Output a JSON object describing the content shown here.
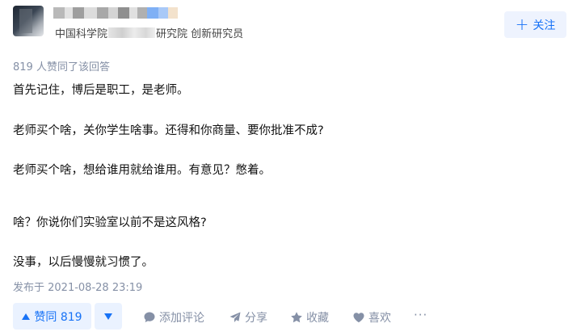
{
  "author": {
    "organization_prefix": "中国科学院",
    "organization_suffix": "研究院 创新研究员",
    "follow_label": "关注"
  },
  "answer": {
    "vote_summary": "819 人赞同了该回答",
    "paragraphs": [
      "首先记住，博后是职工，是老师。",
      "老师买个啥，关你学生啥事。还得和你商量、要你批准不成?",
      "老师买个啥，想给谁用就给谁用。有意见？憋着。",
      "啥？你说你们实验室以前不是这风格?",
      "没事，以后慢慢就习惯了。"
    ],
    "publish_time": "发布于 2021-08-28 23:19"
  },
  "actions": {
    "vote_up_label": "赞同 819",
    "comment_label": "添加评论",
    "share_label": "分享",
    "favorite_label": "收藏",
    "like_label": "喜欢",
    "more_label": "···"
  },
  "colors": {
    "accent": "#1772f6",
    "accent_bg": "#eaf2ff",
    "muted_text": "#8590a6",
    "body_text": "#121212"
  },
  "icons": {
    "follow": "plus-icon",
    "vote_up": "triangle-up-icon",
    "vote_down": "triangle-down-icon",
    "comment": "comment-bubble-icon",
    "share": "paper-plane-icon",
    "favorite": "star-icon",
    "like": "heart-icon",
    "more": "more-dots-icon"
  }
}
